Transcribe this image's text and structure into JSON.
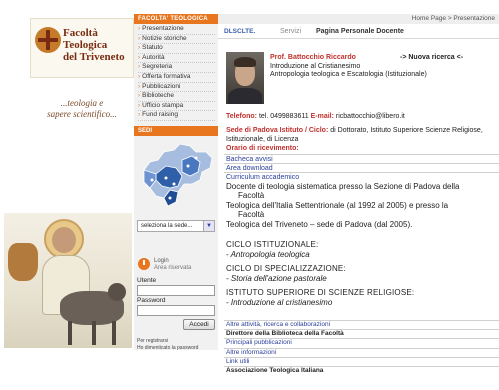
{
  "logo": {
    "line1": "Facoltà",
    "line2": "Teologica",
    "line3": "del Triveneto"
  },
  "tagline": {
    "line1": "...teologia e",
    "line2": "sapere scientifico..."
  },
  "menu": {
    "header": "FACOLTA' TEOLOGICA",
    "items": [
      "Presentazione",
      "Notizie storiche",
      "Statuto",
      "Autorità",
      "Segreteria",
      "Offerta formativa",
      "Pubblicazioni",
      "Biblioteche",
      "Ufficio stampa",
      "Fund raising"
    ],
    "sedi_header": "SEDI",
    "sede_select": "seleziona la sede..."
  },
  "login": {
    "title": "Login",
    "subtitle": "Area riservata",
    "user_label": "Utente",
    "password_label": "Password",
    "submit": "Accedi",
    "register": "Per registrarsi",
    "forgot": "Ho dimenticato la password"
  },
  "topbar": {
    "breadcrumb": "Home Page  >  Presentazione"
  },
  "tabs": {
    "first": "DLSCLTE.",
    "second": "Servizi",
    "third": "Pagina Personale Docente"
  },
  "profile": {
    "name": "Prof. Battocchio Riccardo",
    "course1": "Introduzione al Cristianesimo",
    "course2": "Antropologia teologica e Escatologia (Istituzionale)",
    "new_search": "-> Nuova ricerca <-",
    "phone_label": "Telefono:",
    "phone": "tel. 0499883611",
    "email_label": "E-mail:",
    "email": "ricbattocchio@libero.it",
    "sede_label": "Sede di Padova Istituto / Ciclo:",
    "sede_value": "di Dottorato, Istituto Superiore Scienze Religiose, Istituzionale, di Licenza",
    "orario": "Orario di ricevimento:"
  },
  "links": [
    "Bacheca avvisi",
    "Area download",
    "Curriculum accademico"
  ],
  "description": [
    "Docente di teologia sistematica presso la Sezione di Padova della",
    "Facoltà",
    "Teologica dell'Italia Settentrionale (al 1992 al 2005) e presso la",
    "Facoltà",
    "Teologica del Triveneto – sede di Padova (dal 2005)."
  ],
  "sections": [
    {
      "title": "CICLO ISTITUZIONALE:",
      "item": "- Antropologia teologica"
    },
    {
      "title": "CICLO DI SPECIALIZZAZIONE:",
      "item": "- Storia dell'azione pastorale"
    },
    {
      "title": "ISTITUTO SUPERIORE DI SCIENZE RELIGIOSE:",
      "item": "- Introduzione al cristianesimo"
    }
  ],
  "bottom_links": [
    "Altre attività, ricerca e collaborazioni",
    "Direttore della Biblioteca della Facoltà",
    "Principali pubblicazioni",
    "Altre informazioni",
    "Link utili",
    "Associazione Teologica Italiana"
  ],
  "colors": {
    "accent": "#e8761f",
    "title_red": "#c0312e",
    "link_blue": "#2a3f9a",
    "map_blue": "#2f5fa8"
  }
}
